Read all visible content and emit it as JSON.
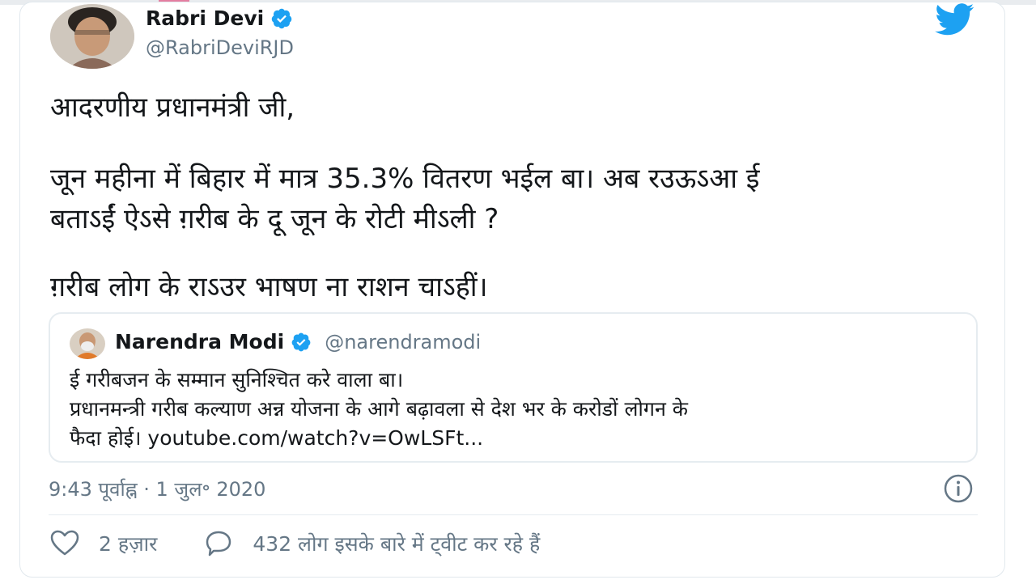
{
  "tweet": {
    "author_name": "Rabri Devi",
    "author_handle": "@RabriDeviRJD",
    "lines": [
      "आदरणीय प्रधानमंत्री जी,",
      "जून महीना में बिहार में मात्र 35.3% वितरण भईल बा। अब रउऊऽआ ई",
      "बताऽईं ऐऽसे ग़रीब के दू जून के रोटी मीऽली ?",
      "ग़रीब लोग के राऽउर भाषण ना राशन चाऽहीं।"
    ],
    "timestamp": "9:43 पूर्वाह्न · 1 जुल॰ 2020",
    "likes_label": "2 हज़ार",
    "replies_label": "432 लोग इसके बारे में ट्वीट कर रहे हैं"
  },
  "quoted": {
    "author_name": "Narendra Modi",
    "author_handle": "@narendramodi",
    "lines": [
      "ई गरीबजन के सम्मान सुनिश्चित करे वाला बा।",
      "प्रधानमन्त्री गरीब कल्याण अन्न योजना के आगे बढ़ावला से देश भर के करोडों लोगन के",
      "फैदा होई। youtube.com/watch?v=OwLSFt..."
    ]
  },
  "icons": {
    "brand": "twitter-bird-icon",
    "verified": "verified-badge-icon",
    "like": "heart-icon",
    "reply": "speech-bubble-icon",
    "info": "info-icon"
  },
  "colors": {
    "brand_blue": "#1da1f2",
    "text": "#14171a",
    "secondary_text": "#657786",
    "border": "#e1e8ed"
  }
}
